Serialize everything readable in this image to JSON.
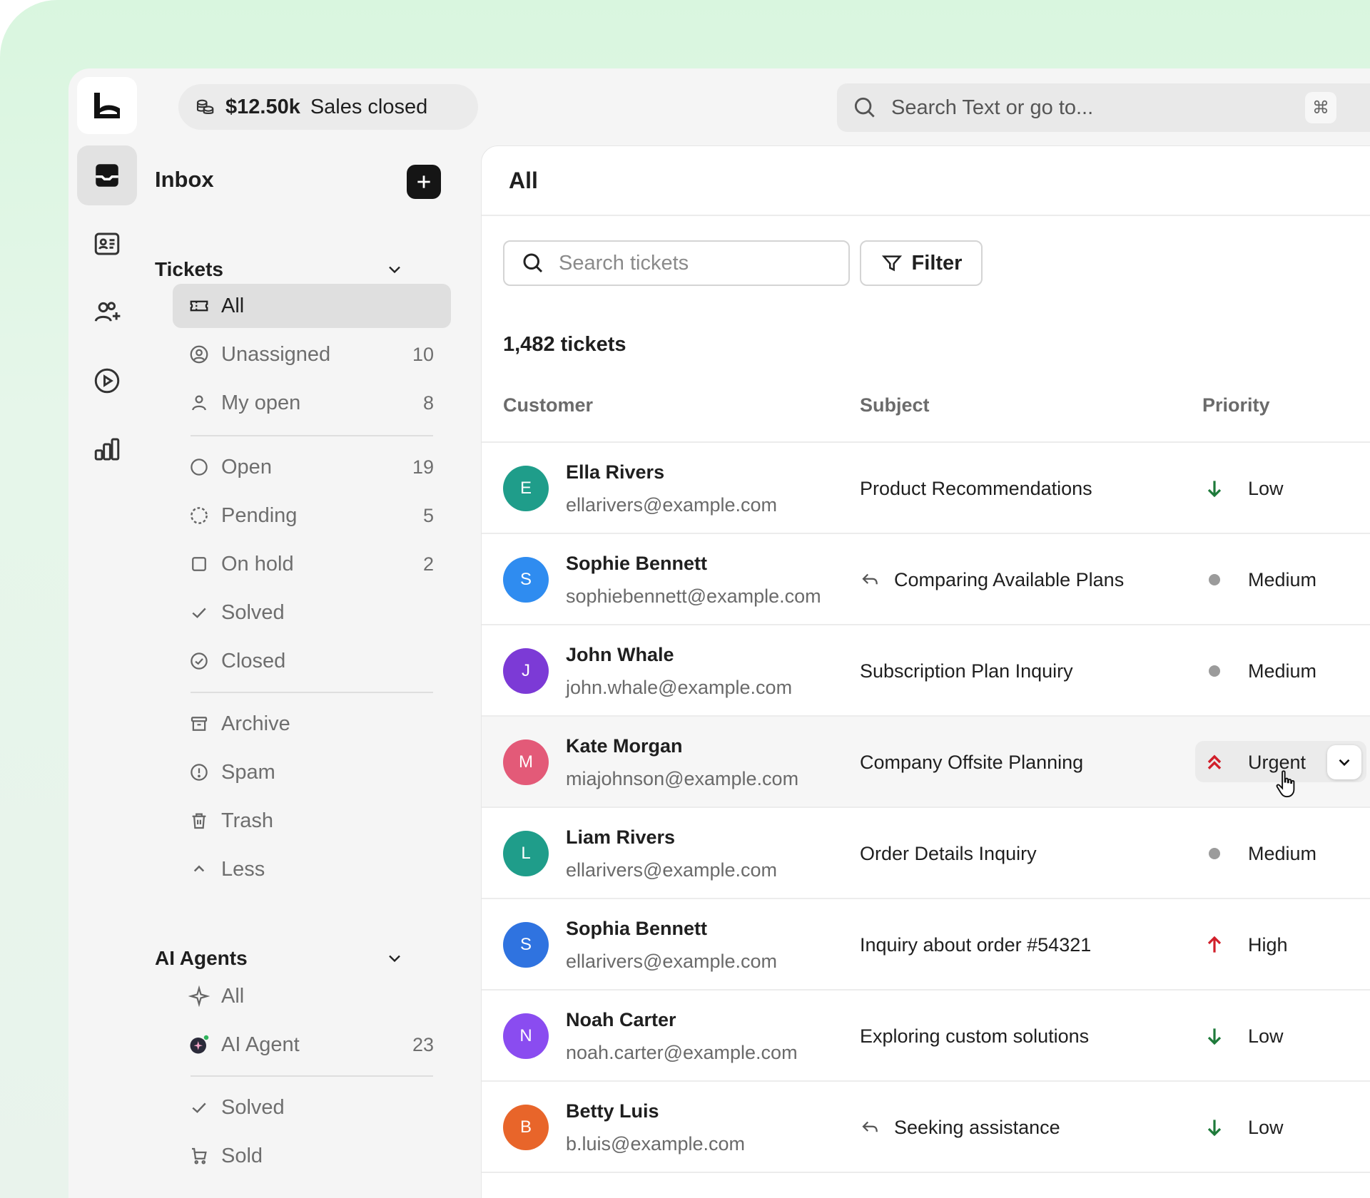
{
  "topbar": {
    "sales_amount": "$12.50k",
    "sales_label": "Sales closed",
    "search_placeholder": "Search Text or go to...",
    "shortcut_key": "⌘"
  },
  "rail": {
    "items": [
      "inbox-icon",
      "contact-card-icon",
      "users-add-icon",
      "play-circle-icon",
      "bar-chart-icon"
    ]
  },
  "nav": {
    "title": "Inbox",
    "tickets_heading": "Tickets",
    "tickets": [
      {
        "label": "All",
        "count": ""
      },
      {
        "label": "Unassigned",
        "count": "10"
      },
      {
        "label": "My open",
        "count": "8"
      }
    ],
    "statuses": [
      {
        "label": "Open",
        "count": "19"
      },
      {
        "label": "Pending",
        "count": "5"
      },
      {
        "label": "On hold",
        "count": "2"
      },
      {
        "label": "Solved",
        "count": ""
      },
      {
        "label": "Closed",
        "count": ""
      }
    ],
    "other": [
      {
        "label": "Archive"
      },
      {
        "label": "Spam"
      },
      {
        "label": "Trash"
      },
      {
        "label": "Less"
      }
    ],
    "agents_heading": "AI Agents",
    "agents": [
      {
        "label": "All",
        "count": ""
      },
      {
        "label": "AI Agent",
        "count": "23"
      }
    ],
    "agent_status": [
      {
        "label": "Solved"
      },
      {
        "label": "Sold"
      }
    ]
  },
  "main": {
    "title": "All",
    "search_placeholder": "Search tickets",
    "filter_label": "Filter",
    "ticket_count": "1,482 tickets",
    "columns": {
      "customer": "Customer",
      "subject": "Subject",
      "priority": "Priority"
    },
    "rows": [
      {
        "initial": "E",
        "color": "#1f9d8a",
        "name": "Ella Rivers",
        "email": "ellarivers@example.com",
        "subject": "Product Recommendations",
        "reply": false,
        "priority": "Low"
      },
      {
        "initial": "S",
        "color": "#2f8cf0",
        "name": "Sophie Bennett",
        "email": "sophiebennett@example.com",
        "subject": "Comparing Available Plans",
        "reply": true,
        "priority": "Medium"
      },
      {
        "initial": "J",
        "color": "#7c3ad6",
        "name": "John Whale",
        "email": "john.whale@example.com",
        "subject": "Subscription Plan Inquiry",
        "reply": false,
        "priority": "Medium"
      },
      {
        "initial": "M",
        "color": "#e35a78",
        "name": "Kate Morgan",
        "email": "miajohnson@example.com",
        "subject": "Company Offsite Planning",
        "reply": false,
        "priority": "Urgent"
      },
      {
        "initial": "L",
        "color": "#1f9d8a",
        "name": "Liam Rivers",
        "email": "ellarivers@example.com",
        "subject": "Order Details Inquiry",
        "reply": false,
        "priority": "Medium"
      },
      {
        "initial": "S",
        "color": "#2f73e0",
        "name": "Sophia Bennett",
        "email": "ellarivers@example.com",
        "subject": "Inquiry about order #54321",
        "reply": false,
        "priority": "High"
      },
      {
        "initial": "N",
        "color": "#8a4cf0",
        "name": "Noah Carter",
        "email": "noah.carter@example.com",
        "subject": "Exploring custom solutions",
        "reply": false,
        "priority": "Low"
      },
      {
        "initial": "B",
        "color": "#e8652a",
        "name": "Betty Luis",
        "email": "b.luis@example.com",
        "subject": "Seeking assistance",
        "reply": true,
        "priority": "Low"
      }
    ]
  },
  "colors": {
    "low": "#1e7a3a",
    "high": "#d11f2a",
    "urgent": "#d11f2a",
    "medium": "#9b9b9b"
  }
}
